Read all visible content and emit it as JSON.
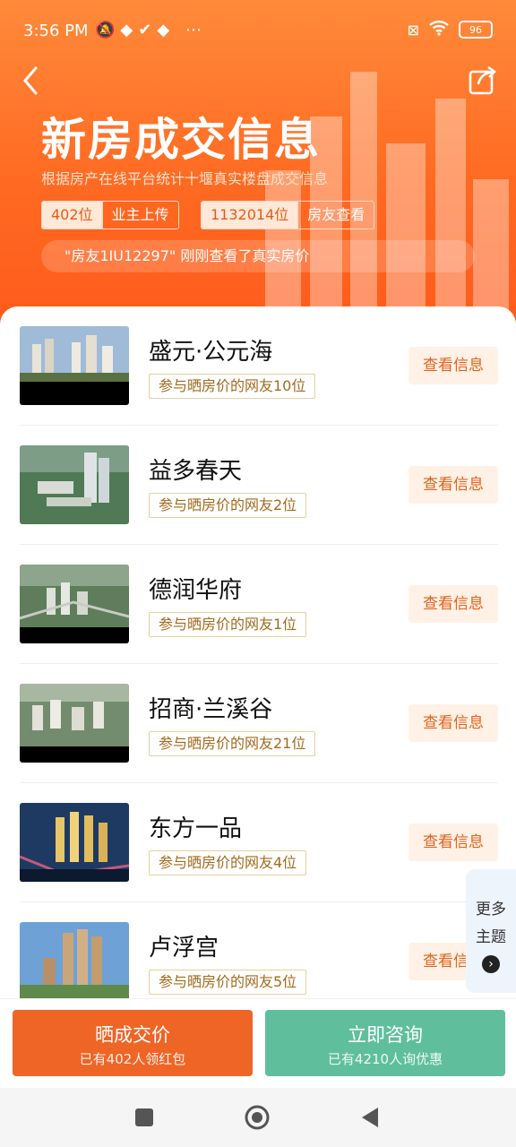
{
  "status_bar": {
    "time": "3:56 PM",
    "left_icons": [
      "mute-icon",
      "app-icon",
      "check-icon",
      "app-icon",
      "more-icon"
    ],
    "right_icons": [
      "sim-off-icon",
      "wifi-icon"
    ],
    "battery": "96"
  },
  "header": {
    "title": "新房成交信息",
    "subtitle": "根据房产在线平台统计十堰真实楼盘成交信息",
    "stats": [
      {
        "number": "402位",
        "label": "业主上传"
      },
      {
        "number": "1132014位",
        "label": "房友查看"
      }
    ],
    "ticker": "\"房友1IU12297\" 刚刚查看了真实房价"
  },
  "listings": [
    {
      "name": "盛元·公元海",
      "tag": "参与晒房价的网友10位",
      "button": "查看信息"
    },
    {
      "name": "益多春天",
      "tag": "参与晒房价的网友2位",
      "button": "查看信息"
    },
    {
      "name": "德润华府",
      "tag": "参与晒房价的网友1位",
      "button": "查看信息"
    },
    {
      "name": "招商·兰溪谷",
      "tag": "参与晒房价的网友21位",
      "button": "查看信息"
    },
    {
      "name": "东方一品",
      "tag": "参与晒房价的网友4位",
      "button": "查看信息"
    },
    {
      "name": "卢浮宫",
      "tag": "参与晒房价的网友5位",
      "button": "查看信息"
    }
  ],
  "more_topics": {
    "line1": "更多",
    "line2": "主题"
  },
  "actions": {
    "share_price": {
      "title": "晒成交价",
      "subtitle": "已有402人领红包"
    },
    "consult": {
      "title": "立即咨询",
      "subtitle": "已有4210人询优惠"
    }
  },
  "colors": {
    "accent": "#ef6525",
    "consult": "#5fbf9d",
    "tag_border": "#e8cf9f"
  }
}
